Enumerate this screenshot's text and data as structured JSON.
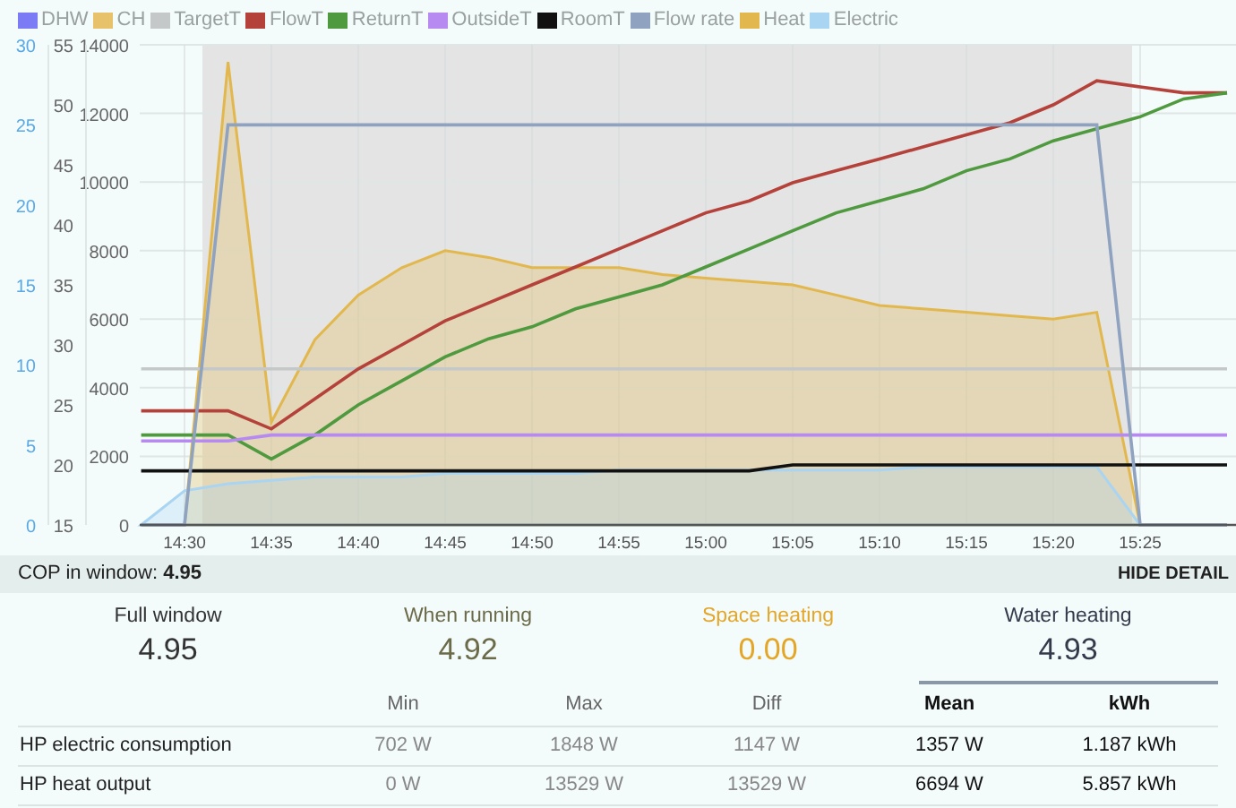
{
  "chart": {
    "selection_window_shown": true,
    "chart_data": {
      "type": "line",
      "categories": [
        null,
        "14:30",
        null,
        "14:35",
        null,
        "14:40",
        null,
        "14:45",
        null,
        "14:50",
        null,
        "14:55",
        null,
        "15:00",
        null,
        "15:05",
        null,
        "15:10",
        null,
        "15:15",
        null,
        "15:20",
        null,
        "15:25",
        null,
        null
      ],
      "ylim": [
        0,
        14000
      ],
      "yticks": [
        0,
        2000,
        4000,
        6000,
        8000,
        10000,
        12000,
        14000
      ],
      "y2lim": [
        15,
        55
      ],
      "y2ticks": [
        15,
        20,
        25,
        30,
        35,
        40,
        45,
        50,
        55
      ],
      "y3lim": [
        0,
        30
      ],
      "y3ticks": [
        0,
        5,
        10,
        15,
        20,
        25,
        30
      ],
      "grid": true,
      "series": [
        {
          "name": "DHW",
          "color": "#7b7bf5",
          "type": "line",
          "values": [
            null,
            null,
            null,
            null,
            null,
            null,
            null,
            null,
            null,
            null,
            null,
            null,
            null,
            null,
            null,
            null,
            null,
            null,
            null,
            null,
            null,
            null,
            null,
            null,
            null,
            null
          ]
        },
        {
          "name": "CH",
          "color": "#e8c26a",
          "type": "line",
          "values": [
            null,
            null,
            null,
            null,
            null,
            null,
            null,
            null,
            null,
            null,
            null,
            null,
            null,
            null,
            null,
            null,
            null,
            null,
            null,
            null,
            null,
            null,
            null,
            null,
            null,
            null
          ]
        },
        {
          "name": "TargetT",
          "color": "#c4c8c8",
          "type": "line",
          "axis": "y2",
          "values": [
            28,
            28,
            28,
            28,
            28,
            28,
            28,
            28,
            28,
            28,
            28,
            28,
            28,
            28,
            28,
            28,
            28,
            28,
            28,
            28,
            28,
            28,
            28,
            28,
            28,
            28
          ]
        },
        {
          "name": "FlowT",
          "color": "#b5423a",
          "type": "line",
          "axis": "y2",
          "values": [
            24.5,
            24.5,
            24.5,
            23,
            25.5,
            28,
            30,
            32,
            33.5,
            35,
            36.5,
            38,
            39.5,
            41,
            42,
            43.5,
            44.5,
            45.5,
            46.5,
            47.5,
            48.5,
            50,
            52,
            51.5,
            51,
            51
          ]
        },
        {
          "name": "ReturnT",
          "color": "#4f9a3f",
          "type": "line",
          "axis": "y2",
          "values": [
            22.5,
            22.5,
            22.5,
            20.5,
            22.5,
            25,
            27,
            29,
            30.5,
            31.5,
            33,
            34,
            35,
            36.5,
            38,
            39.5,
            41,
            42,
            43,
            44.5,
            45.5,
            47,
            48,
            49,
            50.5,
            51
          ]
        },
        {
          "name": "OutsideT",
          "color": "#b68af0",
          "type": "line",
          "axis": "y2",
          "values": [
            22,
            22,
            22,
            22.5,
            22.5,
            22.5,
            22.5,
            22.5,
            22.5,
            22.5,
            22.5,
            22.5,
            22.5,
            22.5,
            22.5,
            22.5,
            22.5,
            22.5,
            22.5,
            22.5,
            22.5,
            22.5,
            22.5,
            22.5,
            22.5,
            22.5
          ]
        },
        {
          "name": "RoomT",
          "color": "#111111",
          "type": "line",
          "axis": "y2",
          "values": [
            19.5,
            19.5,
            19.5,
            19.5,
            19.5,
            19.5,
            19.5,
            19.5,
            19.5,
            19.5,
            19.5,
            19.5,
            19.5,
            19.5,
            19.5,
            20,
            20,
            20,
            20,
            20,
            20,
            20,
            20,
            20,
            20,
            20
          ]
        },
        {
          "name": "Flow rate",
          "color": "#8fa3c0",
          "type": "line",
          "axis": "y3",
          "values": [
            0,
            0,
            25,
            25,
            25,
            25,
            25,
            25,
            25,
            25,
            25,
            25,
            25,
            25,
            25,
            25,
            25,
            25,
            25,
            25,
            25,
            25,
            25,
            0,
            0,
            0
          ]
        },
        {
          "name": "Heat",
          "color": "#e2b84e",
          "type": "area",
          "values": [
            0,
            0,
            13500,
            3000,
            5400,
            6700,
            7500,
            8000,
            7800,
            7500,
            7500,
            7500,
            7300,
            7200,
            7100,
            7000,
            6700,
            6400,
            6300,
            6200,
            6100,
            6000,
            6200,
            0,
            0,
            0
          ]
        },
        {
          "name": "Electric",
          "color": "#a9d4f2",
          "type": "area",
          "values": [
            0,
            1000,
            1200,
            1300,
            1400,
            1400,
            1400,
            1500,
            1500,
            1500,
            1500,
            1600,
            1600,
            1600,
            1600,
            1600,
            1600,
            1600,
            1700,
            1700,
            1700,
            1700,
            1700,
            0,
            0,
            0
          ]
        }
      ]
    }
  },
  "cop_bar": {
    "label": "COP in window:",
    "value": "4.95",
    "button": "HIDE DETAIL"
  },
  "stats": [
    {
      "label": "Full window",
      "value": "4.95",
      "color": "#333333",
      "selected": false
    },
    {
      "label": "When running",
      "value": "4.92",
      "color": "#6b6b4a",
      "selected": false
    },
    {
      "label": "Space heating",
      "value": "0.00",
      "color": "#e3a628",
      "selected": false
    },
    {
      "label": "Water heating",
      "value": "4.93",
      "color": "#333a4a",
      "selected": true
    }
  ],
  "table": {
    "columns": [
      {
        "label": "Min",
        "bold": false
      },
      {
        "label": "Max",
        "bold": false
      },
      {
        "label": "Diff",
        "bold": false
      },
      {
        "label": "Mean",
        "bold": true
      },
      {
        "label": "kWh",
        "bold": true
      }
    ],
    "rows": [
      {
        "label": "HP electric consumption",
        "cells": [
          "702 W",
          "1848 W",
          "1147 W",
          "1357 W",
          "1.187 kWh"
        ]
      },
      {
        "label": "HP heat output",
        "cells": [
          "0 W",
          "13529 W",
          "13529 W",
          "6694 W",
          "5.857 kWh"
        ]
      }
    ]
  }
}
